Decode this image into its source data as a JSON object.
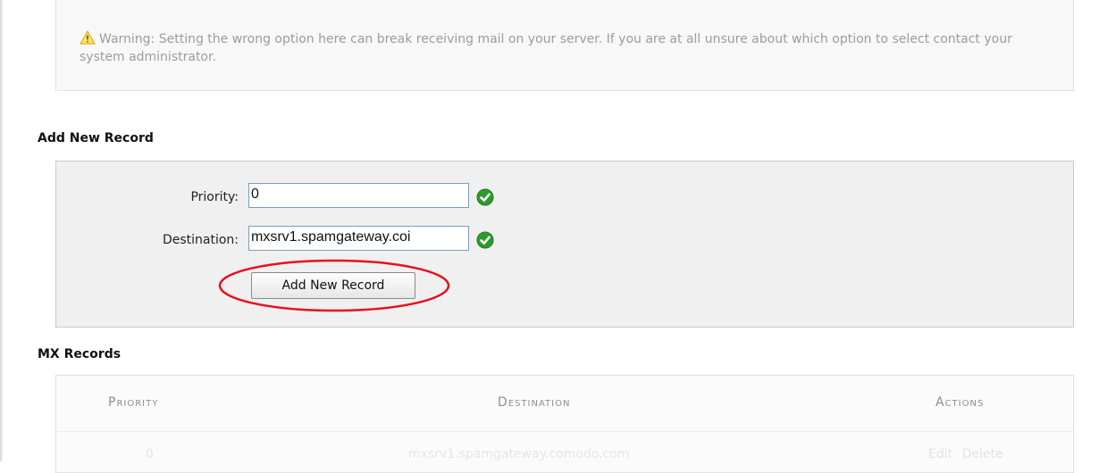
{
  "warning": {
    "icon": "warning-triangle-icon",
    "text": "Warning: Setting the wrong option here can break receiving mail on your server. If you are at all unsure about which option to select contact your system administrator."
  },
  "add_record": {
    "heading": "Add New Record",
    "priority_label": "Priority:",
    "priority_value": "0",
    "destination_label": "Destination:",
    "destination_value": "mxsrv1.spamgateway.coi",
    "valid_icon": "checkmark-icon",
    "button_label": "Add New Record",
    "highlight_color": "#e8101a"
  },
  "mx_records": {
    "heading": "MX Records",
    "columns": [
      "Priority",
      "Destination",
      "Actions"
    ],
    "rows": [
      {
        "priority": "0",
        "destination": "mxsrv1.spamgateway.comodo.com",
        "actions": [
          "Edit",
          "Delete"
        ]
      }
    ]
  },
  "colors": {
    "valid_green": "#2e9a2e",
    "warning_yellow": "#f2c200"
  }
}
